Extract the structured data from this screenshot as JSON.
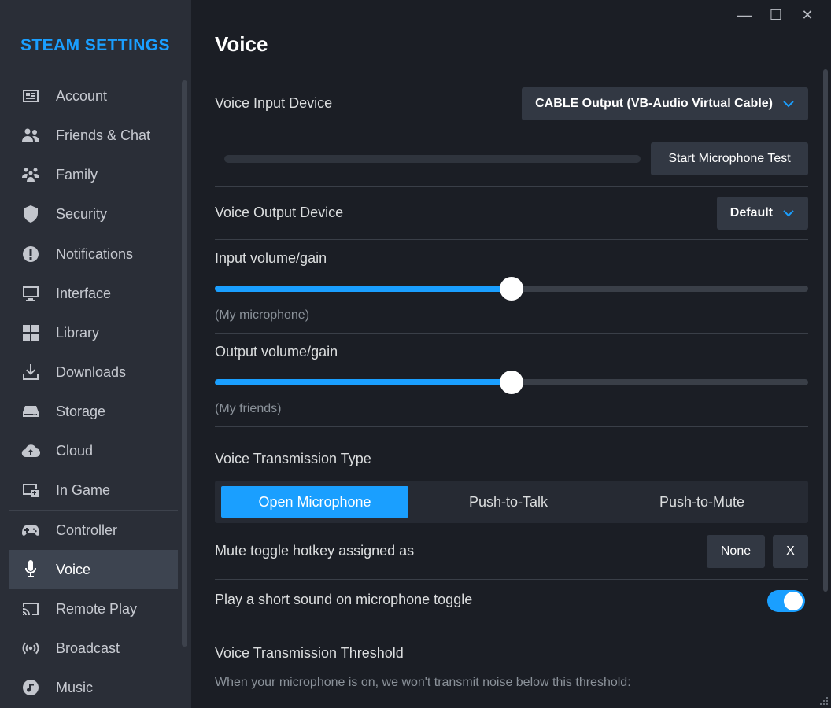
{
  "sidebar": {
    "title": "STEAM SETTINGS",
    "items": [
      {
        "label": "Account",
        "icon": "account-card-icon"
      },
      {
        "label": "Friends & Chat",
        "icon": "friends-icon"
      },
      {
        "label": "Family",
        "icon": "family-icon"
      },
      {
        "label": "Security",
        "icon": "shield-icon"
      },
      {
        "label": "Notifications",
        "icon": "alert-circle-icon"
      },
      {
        "label": "Interface",
        "icon": "monitor-icon"
      },
      {
        "label": "Library",
        "icon": "grid-icon"
      },
      {
        "label": "Downloads",
        "icon": "download-icon"
      },
      {
        "label": "Storage",
        "icon": "drive-icon"
      },
      {
        "label": "Cloud",
        "icon": "cloud-sync-icon"
      },
      {
        "label": "In Game",
        "icon": "in-game-icon"
      },
      {
        "label": "Controller",
        "icon": "gamepad-icon"
      },
      {
        "label": "Voice",
        "icon": "microphone-icon",
        "active": true
      },
      {
        "label": "Remote Play",
        "icon": "cast-icon"
      },
      {
        "label": "Broadcast",
        "icon": "broadcast-icon"
      },
      {
        "label": "Music",
        "icon": "music-icon"
      }
    ]
  },
  "window": {
    "minimize": "—",
    "maximize": "☐",
    "close": "✕"
  },
  "main": {
    "title": "Voice",
    "input_device": {
      "label": "Voice Input Device",
      "value": "CABLE Output (VB-Audio Virtual Cable)"
    },
    "mic_test_button": "Start Microphone Test",
    "output_device": {
      "label": "Voice Output Device",
      "value": "Default"
    },
    "input_volume": {
      "label": "Input volume/gain",
      "sublabel": "(My microphone)",
      "level": 0.5
    },
    "output_volume": {
      "label": "Output volume/gain",
      "sublabel": "(My friends)",
      "level": 0.5
    },
    "transmission": {
      "label": "Voice Transmission Type",
      "options": [
        "Open Microphone",
        "Push-to-Talk",
        "Push-to-Mute"
      ],
      "selected": 0
    },
    "mute_hotkey": {
      "label": "Mute toggle hotkey assigned as",
      "value": "None",
      "clear": "X"
    },
    "toggle_sound": {
      "label": "Play a short sound on microphone toggle",
      "enabled": true
    },
    "threshold": {
      "label": "Voice Transmission Threshold",
      "description": "When your microphone is on, we won't transmit noise below this threshold:"
    }
  },
  "colors": {
    "accent": "#1a9fff",
    "sidebar_bg": "#2a2e37",
    "main_bg": "#1b1e25"
  }
}
